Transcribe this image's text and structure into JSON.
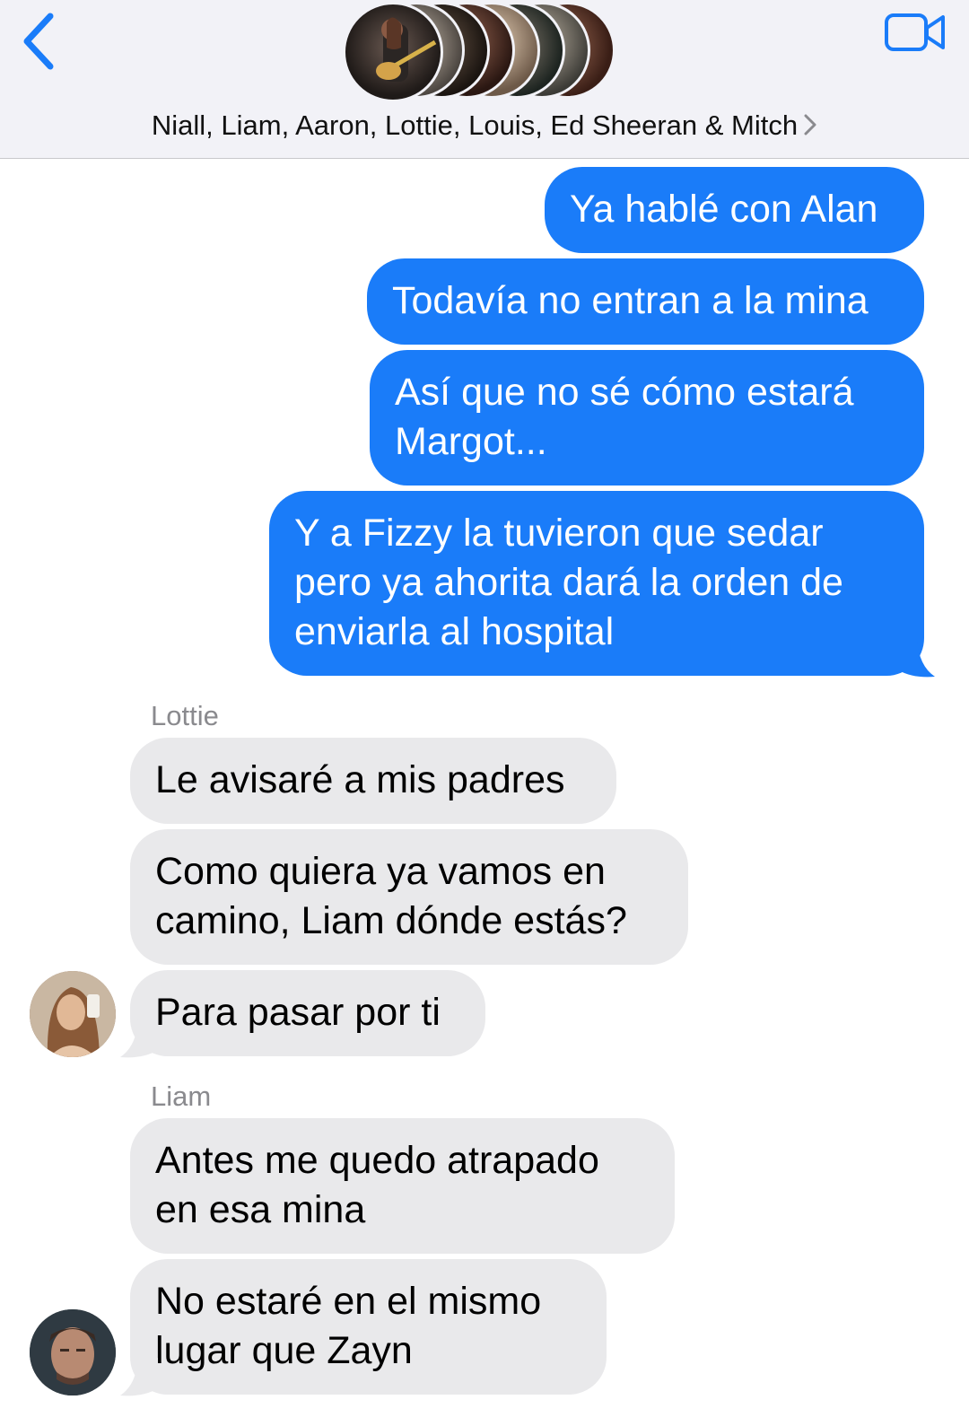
{
  "header": {
    "back_icon": "chevron-left-icon",
    "video_icon": "video-camera-icon",
    "group_title": "Niall, Liam, Aaron, Lottie, Louis, Ed Sheeran & Mitch",
    "title_chevron_icon": "chevron-right-icon",
    "accent_color": "#1a7cf9"
  },
  "messages": {
    "outgoing": [
      {
        "text": "Ya hablé con Alan"
      },
      {
        "text": "Todavía no entran a la mina"
      },
      {
        "text": "Así que no sé cómo estará\nMargot..."
      },
      {
        "text": "Y a Fizzy la tuvieron que sedar\npero ya ahorita dará la orden de\nenviarla al hospital"
      }
    ],
    "lottie": {
      "sender": "Lottie",
      "items": [
        {
          "text": "Le avisaré a mis padres"
        },
        {
          "text": "Como quiera ya vamos en\ncamino, Liam dónde estás?"
        },
        {
          "text": "Para pasar por ti"
        }
      ]
    },
    "liam": {
      "sender": "Liam",
      "items": [
        {
          "text": "Antes me quedo atrapado\nen esa mina"
        },
        {
          "text": "No estaré en el mismo\nlugar que Zayn"
        }
      ]
    }
  },
  "colors": {
    "outgoing_bubble": "#1a7cf9",
    "incoming_bubble": "#e9e9eb",
    "header_bg": "#f2f2f7"
  }
}
